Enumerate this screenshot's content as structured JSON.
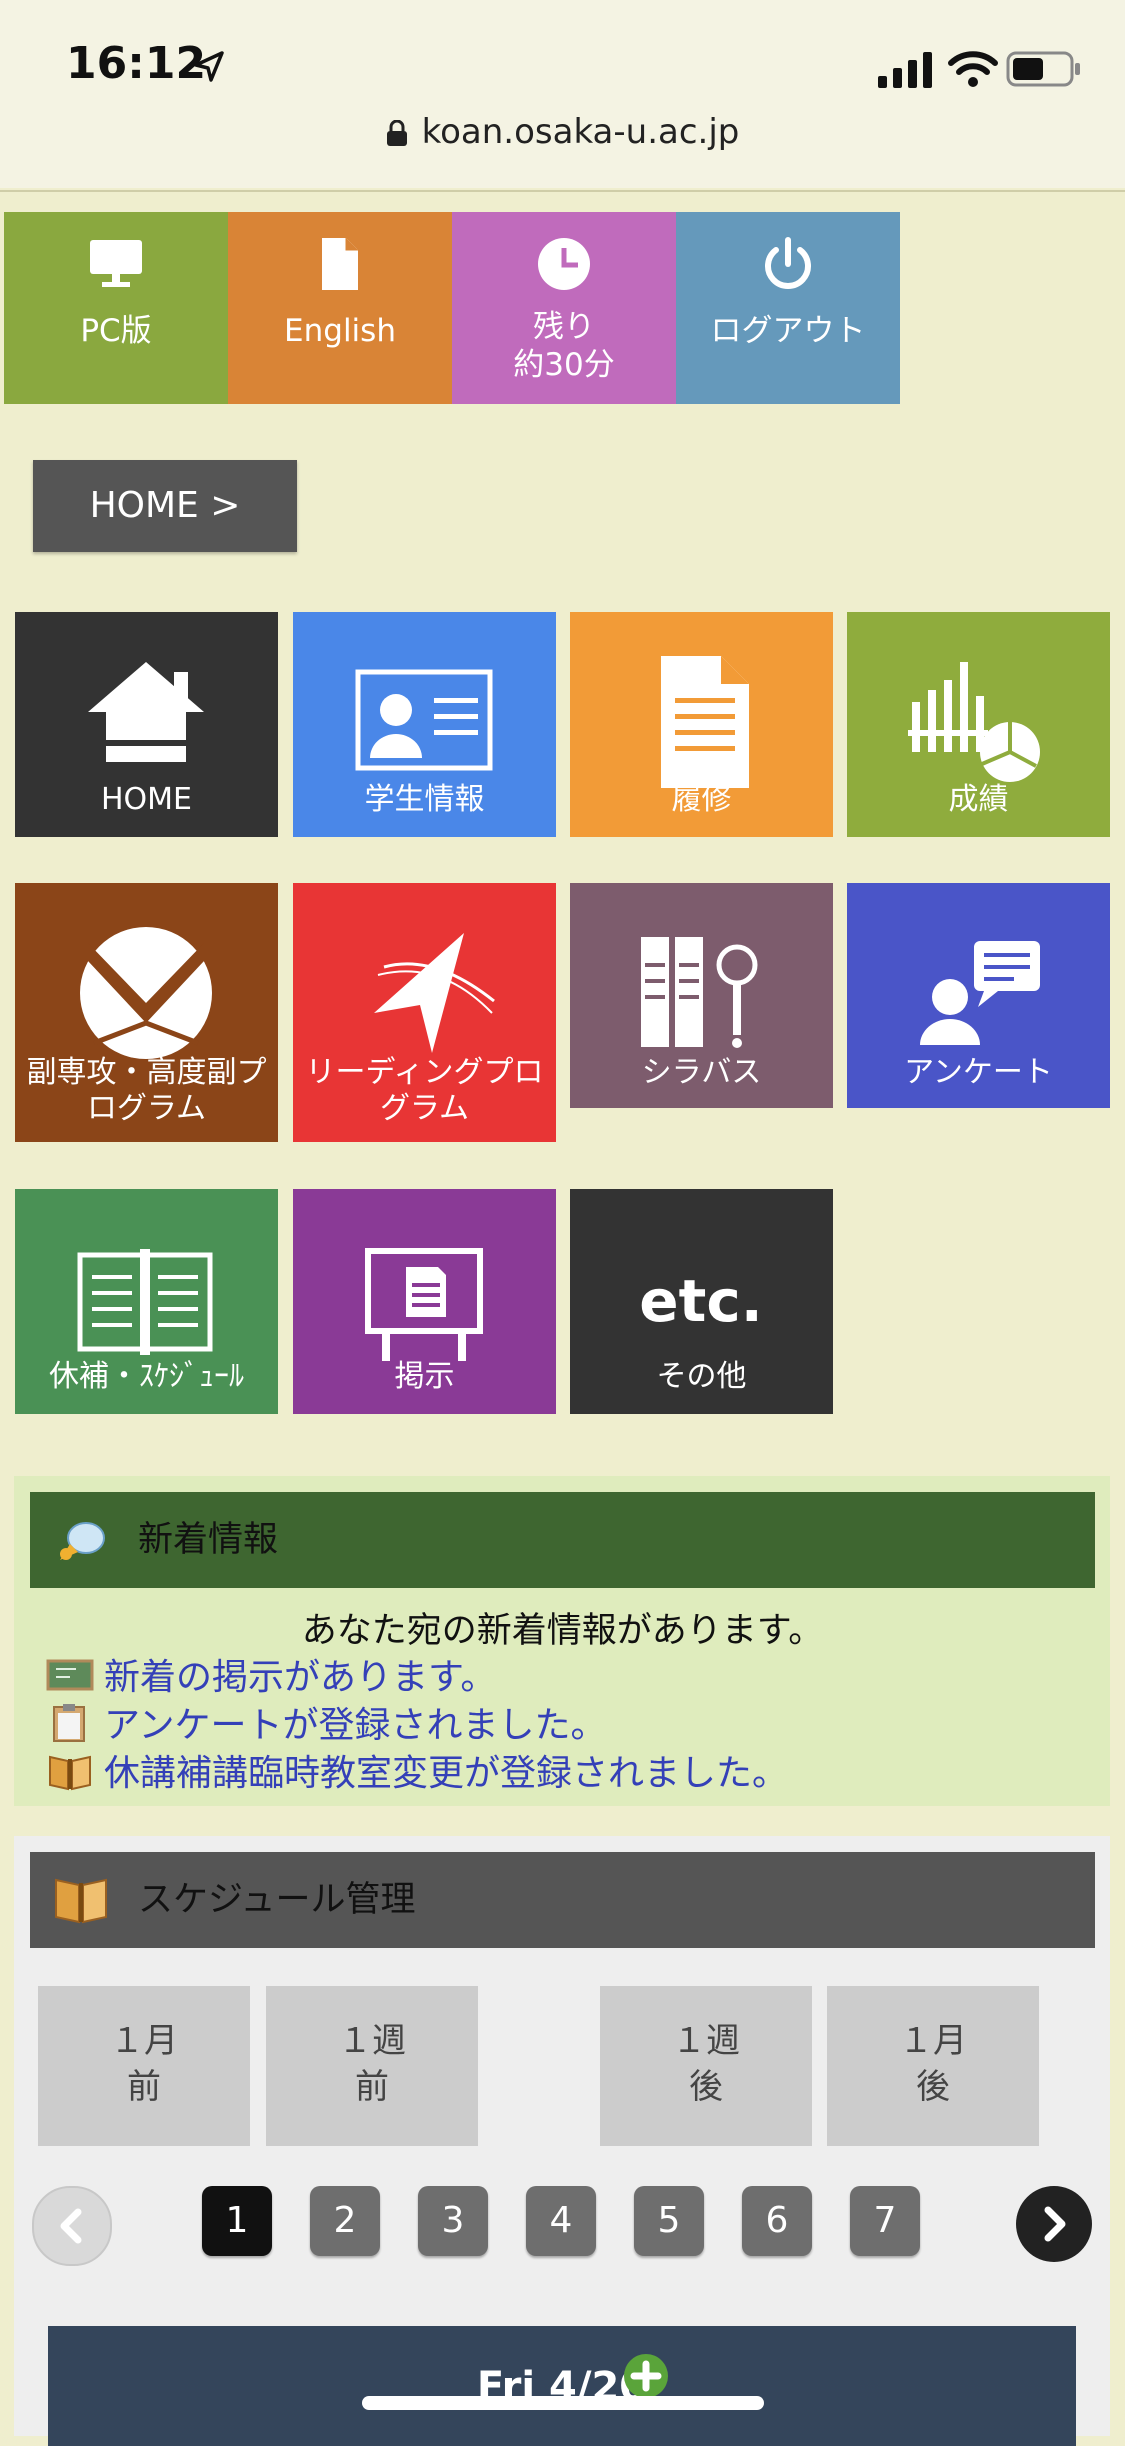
{
  "status_bar": {
    "time": "16:12"
  },
  "browser": {
    "url": "koan.osaka-u.ac.jp"
  },
  "top_buttons": [
    {
      "label": "PC版",
      "icon": "monitor-icon",
      "color": "#8aa83f"
    },
    {
      "label": "English",
      "icon": "document-icon",
      "color": "#d98436"
    },
    {
      "label": "残り\n約30分",
      "icon": "clock-icon",
      "color": "#c06bbc"
    },
    {
      "label": "ログアウト",
      "icon": "power-icon",
      "color": "#6599bb"
    }
  ],
  "breadcrumb": {
    "label": "HOME >"
  },
  "tiles": [
    {
      "label": "HOME",
      "icon": "house-icon",
      "color": "#333333"
    },
    {
      "label": "学生情報",
      "icon": "id-card-icon",
      "color": "#4a87e8"
    },
    {
      "label": "履修",
      "icon": "document-icon",
      "color": "#f29b37"
    },
    {
      "label": "成績",
      "icon": "chart-icon",
      "color": "#8fac3d"
    },
    {
      "label": "副専攻・高度副プ\nログラム",
      "icon": "circle-segment-icon",
      "color": "#8b4518"
    },
    {
      "label": "リーディングプロ\nグラム",
      "icon": "star-arrow-icon",
      "color": "#e83535"
    },
    {
      "label": "シラバス",
      "icon": "books-magnifier-icon",
      "color": "#7d5c6d"
    },
    {
      "label": "アンケート",
      "icon": "person-speech-icon",
      "color": "#4a55c8"
    },
    {
      "label": "休補・ｽｹｼﾞｭｰﾙ",
      "icon": "notebook-icon",
      "color": "#4a9155"
    },
    {
      "label": "掲示",
      "icon": "board-icon",
      "color": "#8a3a96"
    },
    {
      "label": "その他",
      "icon": "etc-icon",
      "color": "#333333",
      "icon_text": "etc."
    }
  ],
  "news": {
    "title": "新着情報",
    "intro": "あなた宛の新着情報があります。",
    "items": [
      {
        "label": "新着の掲示があります。",
        "icon": "blackboard-icon"
      },
      {
        "label": "アンケートが登録されました。",
        "icon": "clipboard-icon"
      },
      {
        "label": "休講補講臨時教室変更が登録されました。",
        "icon": "schedule-book-icon"
      }
    ]
  },
  "schedule": {
    "title": "スケジュール管理",
    "nav": [
      "１月\n前",
      "１週\n前",
      "１週\n後",
      "１月\n後"
    ],
    "pages": [
      "1",
      "2",
      "3",
      "4",
      "5",
      "6",
      "7"
    ],
    "active_page": "1",
    "day_header": "Fri 4/20"
  }
}
